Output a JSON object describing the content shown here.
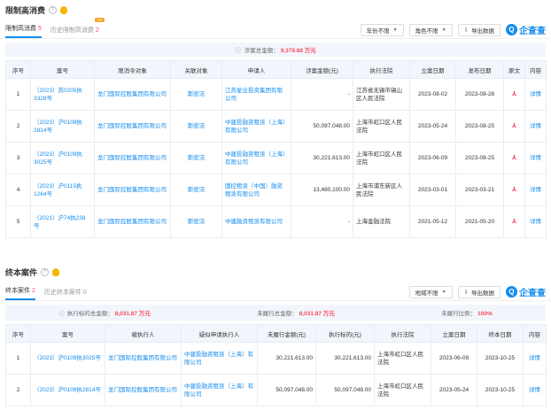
{
  "section1": {
    "title": "限制高消费",
    "tabs": [
      {
        "label": "限制高消费",
        "count": "5"
      },
      {
        "label": "历史限制高消费",
        "count": "2",
        "badge": "VIP"
      }
    ],
    "filters": [
      "年份不限",
      "角色不限"
    ],
    "export_label": "导出数据",
    "summary_label": "涉案总金额：",
    "summary_value": "9,379.88 万元",
    "columns": [
      "序号",
      "案号",
      "限消令对象",
      "关联对象",
      "申请人",
      "涉案金额(元)",
      "执行法院",
      "立案日期",
      "发布日期",
      "原文",
      "内容"
    ],
    "rows": [
      {
        "no": "1",
        "case": "（2023）苏0205执3328号",
        "target": "龙门国际控股集团有限公司",
        "related": "斯密洁",
        "applicant": "江苏星业投资集团有限公司",
        "amount": "-",
        "court": "江苏省无锡市锡山区人民法院",
        "filed": "2023-08-02",
        "published": "2023-08-28",
        "detail": "详情"
      },
      {
        "no": "2",
        "case": "（2023）沪0109执2814号",
        "target": "龙门国际控股集团有限公司",
        "related": "斯密洁",
        "applicant": "中建投融资租赁（上海）有限公司",
        "amount": "50,097,048.00",
        "court": "上海市虹口区人民法院",
        "filed": "2023-05-24",
        "published": "2023-08-25",
        "detail": "详情"
      },
      {
        "no": "3",
        "case": "（2023）沪0109执3025号",
        "target": "龙门国际控股集团有限公司",
        "related": "斯密洁",
        "applicant": "中建投融资租赁（上海）有限公司",
        "amount": "30,221,613.00",
        "court": "上海市虹口区人民法院",
        "filed": "2023-06-09",
        "published": "2023-08-25",
        "detail": "详情"
      },
      {
        "no": "4",
        "case": "（2023）沪0115执1264号",
        "target": "龙门国际控股集团有限公司",
        "related": "斯密洁",
        "applicant": "国控租赁（中国）融资租赁有限公司",
        "amount": "13,480,100.00",
        "court": "上海市浦东新区人民法院",
        "filed": "2023-03-01",
        "published": "2023-03-21",
        "detail": "详情"
      },
      {
        "no": "5",
        "case": "（2021）沪74执238号",
        "target": "龙门国际控股集团有限公司",
        "related": "斯密洁",
        "applicant": "中建融资租赁有限公司",
        "amount": "-",
        "court": "上海金融法院",
        "filed": "2021-05-12",
        "published": "2021-05-20",
        "detail": "详情"
      }
    ]
  },
  "section2": {
    "title": "终本案件",
    "tabs": [
      {
        "label": "终本案件",
        "count": "2"
      },
      {
        "label": "历史终本案件",
        "count": "0"
      }
    ],
    "filters": [
      "地域不限"
    ],
    "export_label": "导出数据",
    "summary": [
      {
        "label": "执行标的总金额：",
        "value": "8,031.87 万元"
      },
      {
        "label": "未履行总金额：",
        "value": "8,031.87 万元"
      },
      {
        "label": "未履行比例：",
        "value": "100%"
      }
    ],
    "columns": [
      "序号",
      "案号",
      "被执行人",
      "疑似申请执行人",
      "未履行金额(元)",
      "执行标的(元)",
      "执行法院",
      "立案日期",
      "终本日期",
      "内容"
    ],
    "rows": [
      {
        "no": "1",
        "case": "（2023）沪0109执3025号",
        "debtor": "龙门国际控股集团有限公司",
        "applicant": "中建投融资租赁（上海）有限公司",
        "unpaid": "30,221,613.00",
        "target": "30,221,613.00",
        "court": "上海市虹口区人民法院",
        "filed": "2023-06-09",
        "ended": "2023-10-25",
        "detail": "详情"
      },
      {
        "no": "2",
        "case": "（2023）沪0109执2814号",
        "debtor": "龙门国际控股集团有限公司",
        "applicant": "中建投融资租赁（上海）有限公司",
        "unpaid": "50,097,048.00",
        "target": "50,097,048.00",
        "court": "上海市虹口区人民法院",
        "filed": "2023-05-24",
        "ended": "2023-10-25",
        "detail": "详情"
      }
    ]
  },
  "brand": {
    "logo_text": "企查查",
    "logo_letter": "Q",
    "accent": "#128bed",
    "alert": "#fd485e"
  },
  "icons": {
    "help": "?",
    "pdf": "⅄",
    "caret": "▼",
    "export": "⇩",
    "info": "ⓘ"
  }
}
